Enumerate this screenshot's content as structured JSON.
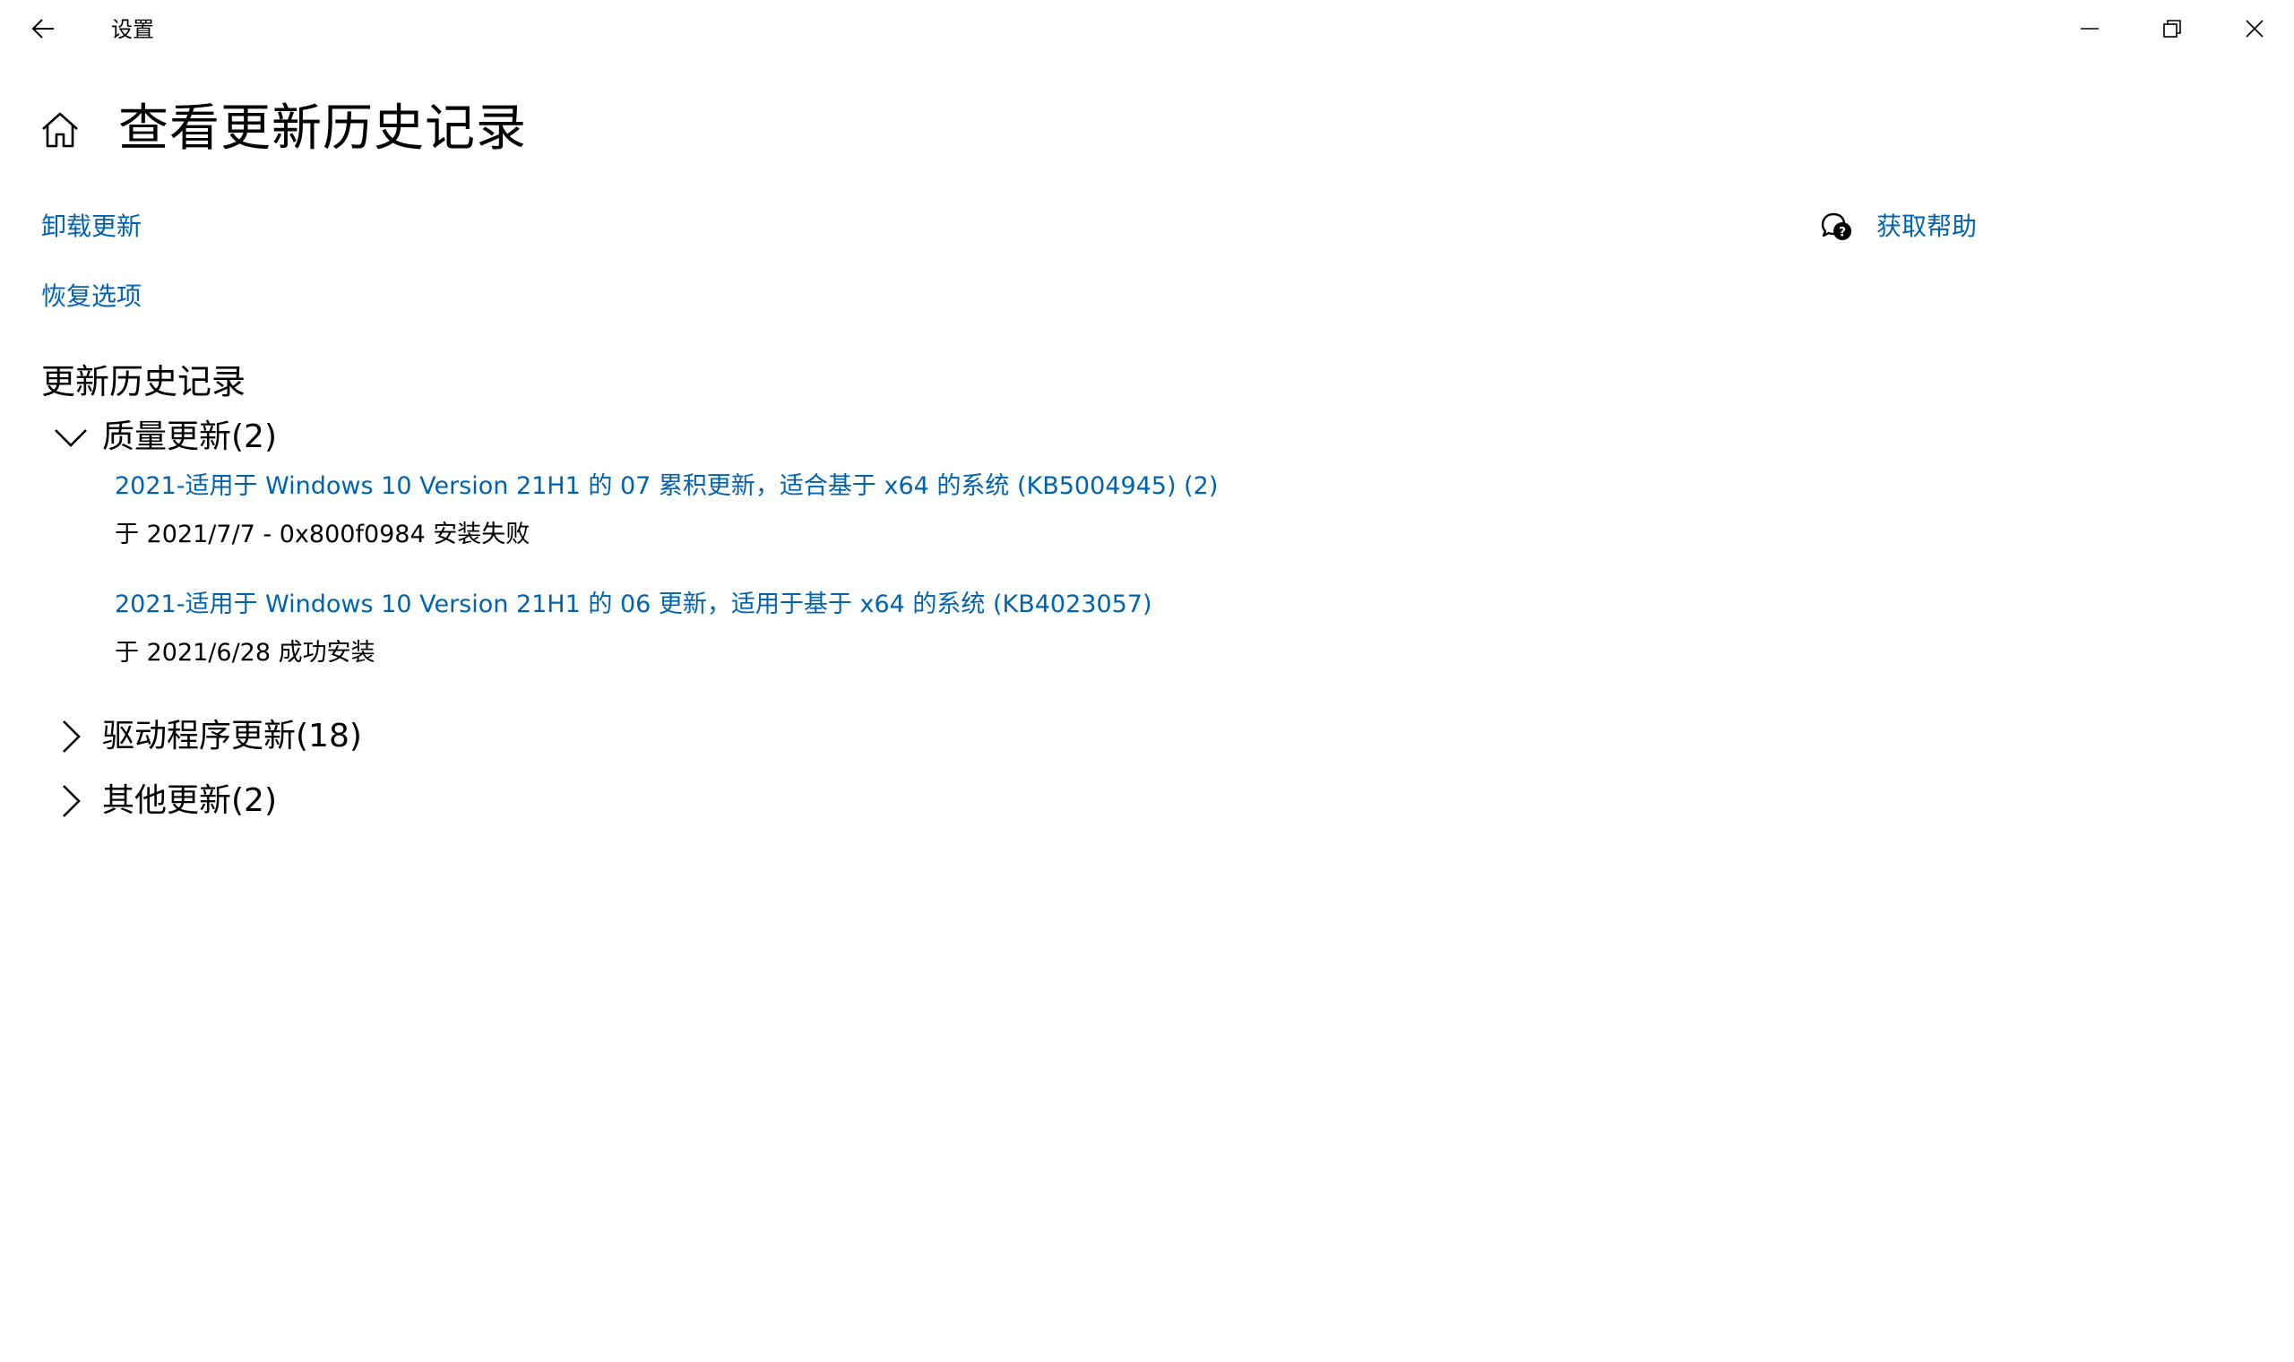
{
  "window": {
    "title": "设置",
    "back_icon": "back-arrow-icon",
    "minimize_icon": "minimize-icon",
    "restore_icon": "restore-icon",
    "close_icon": "close-icon"
  },
  "header": {
    "home_icon": "home-icon",
    "title": "查看更新历史记录"
  },
  "links": {
    "uninstall": "卸载更新",
    "recovery": "恢复选项",
    "help": "获取帮助",
    "help_icon": "chat-help-icon"
  },
  "history": {
    "title": "更新历史记录",
    "groups": [
      {
        "label": "质量更新(2)",
        "expanded": true,
        "items": [
          {
            "name": "2021-适用于 Windows 10 Version 21H1 的 07 累积更新，适合基于 x64 的系统 (KB5004945) (2)",
            "status": "于 2021/7/7 - 0x800f0984 安装失败"
          },
          {
            "name": "2021-适用于 Windows 10 Version 21H1 的 06 更新，适用于基于 x64 的系统 (KB4023057)",
            "status": "于 2021/6/28 成功安装"
          }
        ]
      },
      {
        "label": "驱动程序更新(18)",
        "expanded": false
      },
      {
        "label": "其他更新(2)",
        "expanded": false
      }
    ]
  },
  "colors": {
    "link": "#0063b1",
    "text": "#000000",
    "background": "#ffffff"
  }
}
